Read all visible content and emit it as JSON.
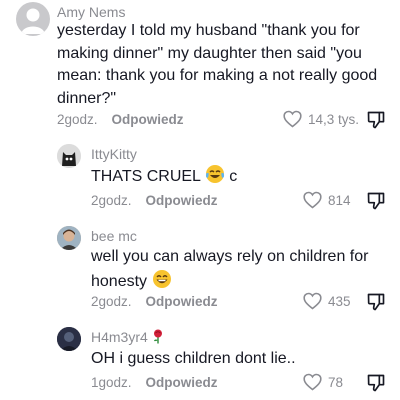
{
  "comments": [
    {
      "username": "Amy Nems",
      "text": "yesterday I told my husband \"thank you for making dinner\" my daughter then said \"you mean: thank you for making a not really good dinner?\"",
      "time": "2godz.",
      "reply_label": "Odpowiedz",
      "likes": "14,3 tys."
    },
    {
      "username": "IttyKitty",
      "text": "THATS CRUEL",
      "text_suffix": "c",
      "emoji": "crying-laughing-emoji",
      "time": "2godz.",
      "reply_label": "Odpowiedz",
      "likes": "814"
    },
    {
      "username": "bee mc",
      "text": "well you can always rely on children for honesty",
      "emoji": "laughing-emoji",
      "time": "2godz.",
      "reply_label": "Odpowiedz",
      "likes": "435"
    },
    {
      "username": "H4m3yr4",
      "username_emoji": "rose-emoji",
      "text": "OH i guess children dont lie..",
      "time": "1godz.",
      "reply_label": "Odpowiedz",
      "likes": "78"
    }
  ],
  "colors": {
    "text": "#161823",
    "secondary": "#8a8b91",
    "background": "#ffffff"
  }
}
